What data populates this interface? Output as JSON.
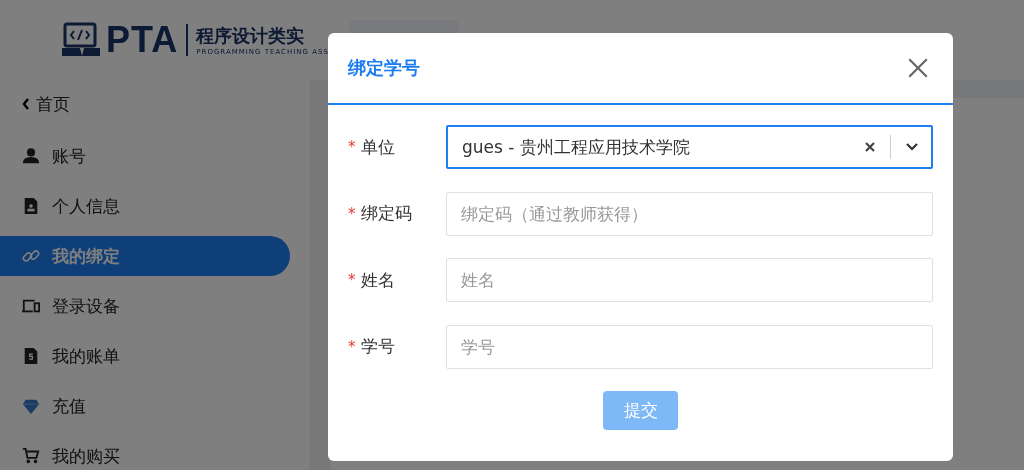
{
  "header": {
    "logo": "PTA",
    "title": "程序设计类实",
    "subtitle": "PROGRAMMING TEACHING ASS"
  },
  "sidebar": {
    "back": "首页",
    "items": [
      {
        "label": "账号",
        "selected": false
      },
      {
        "label": "个人信息",
        "selected": false
      },
      {
        "label": "我的绑定",
        "selected": true
      },
      {
        "label": "登录设备",
        "selected": false
      },
      {
        "label": "我的账单",
        "selected": false
      },
      {
        "label": "充值",
        "selected": false
      },
      {
        "label": "我的购买",
        "selected": false
      }
    ]
  },
  "dialog": {
    "title": "绑定学号",
    "fields": [
      {
        "kind": "select",
        "marker": "*",
        "label": "单位",
        "value": "gues - 贵州工程应用技术学院",
        "focused": true
      },
      {
        "kind": "input",
        "marker": "*",
        "label": "绑定码",
        "placeholder": "绑定码（通过教师获得）",
        "focused": false
      },
      {
        "kind": "input",
        "marker": "*",
        "label": "姓名",
        "placeholder": "姓名",
        "focused": false
      },
      {
        "kind": "input",
        "marker": "*",
        "label": "学号",
        "placeholder": "学号",
        "focused": false
      }
    ],
    "submit": {
      "label": "提交",
      "disabled": true
    }
  }
}
